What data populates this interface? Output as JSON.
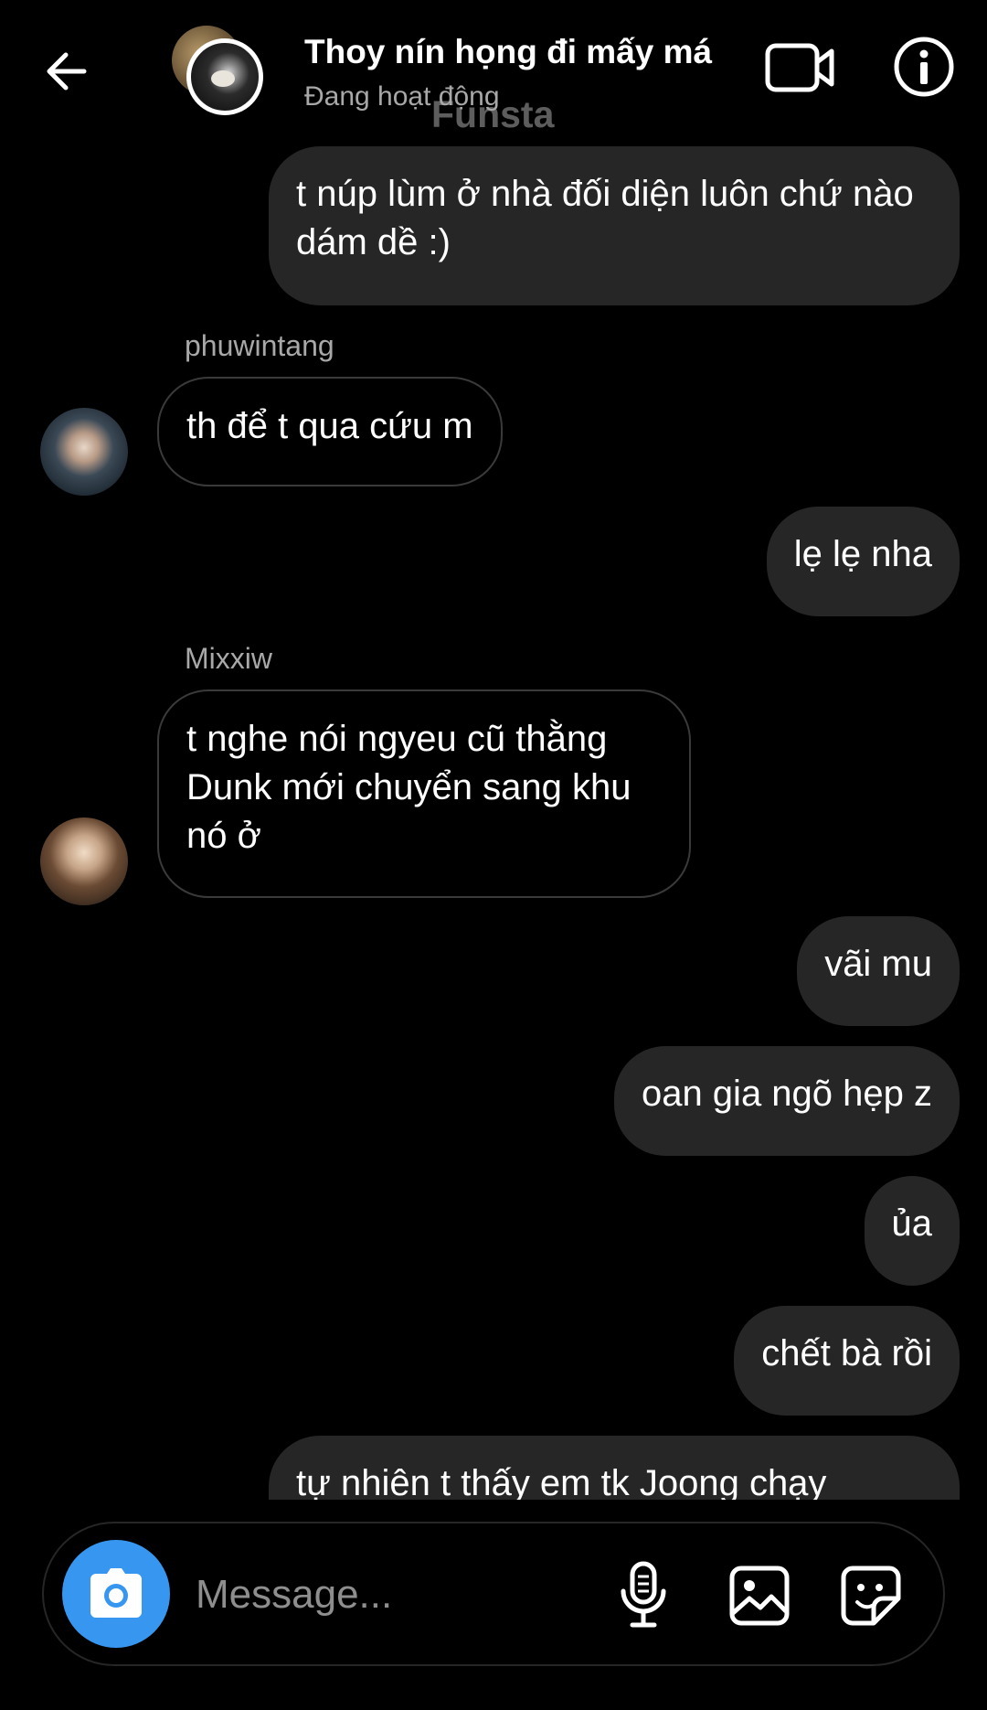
{
  "header": {
    "title": "Thoy nín họng đi mấy má",
    "status": "Đang hoạt động",
    "watermark": "Funsta",
    "icons": {
      "back": "back-arrow-icon",
      "video": "video-call-icon",
      "info": "info-icon"
    }
  },
  "messages": [
    {
      "direction": "out",
      "text": "t núp lùm ở nhà đối diện luôn chứ nào dám dề :)"
    },
    {
      "direction": "in",
      "sender": "phuwintang",
      "text": "th để t qua cứu m"
    },
    {
      "direction": "out",
      "text": "lẹ lẹ nha"
    },
    {
      "direction": "in",
      "sender": "Mixxiw",
      "text": "t nghe nói ngyeu cũ thằng Dunk mới chuyển sang khu nó ở"
    },
    {
      "direction": "out",
      "text": "vãi mu"
    },
    {
      "direction": "out",
      "text": "oan gia ngõ hẹp z"
    },
    {
      "direction": "out",
      "text": "ủa"
    },
    {
      "direction": "out",
      "text": "chết bà rồi"
    },
    {
      "direction": "out",
      "text": "tự nhiên t thấy em tk Joong chạy"
    }
  ],
  "composer": {
    "placeholder": "Message...",
    "icons": {
      "camera": "camera-icon",
      "mic": "microphone-icon",
      "gallery": "gallery-icon",
      "sticker": "sticker-icon"
    },
    "camera_color": "#3797f0"
  },
  "colors": {
    "background": "#000000",
    "outgoing_bubble": "#262626",
    "incoming_border": "#3a3a3a",
    "secondary_text": "#a8a8a8"
  }
}
